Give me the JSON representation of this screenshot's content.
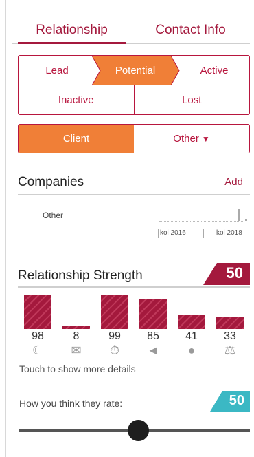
{
  "tabs": [
    {
      "label": "Relationship",
      "active": true
    },
    {
      "label": "Contact Info",
      "active": false
    }
  ],
  "stages": {
    "row1": [
      "Lead",
      "Potential",
      "Active"
    ],
    "selected": "Potential",
    "row2": [
      "Inactive",
      "Lost"
    ]
  },
  "type": {
    "client_label": "Client",
    "other_label": "Other",
    "selected": "Client"
  },
  "companies": {
    "title": "Companies",
    "add_label": "Add",
    "row_label": "Other",
    "timeline": [
      "kol 2016",
      "kol 2018"
    ]
  },
  "strength": {
    "title": "Relationship Strength",
    "score": "50",
    "metrics": [
      {
        "value": 98,
        "label": "98",
        "icon": "moon-icon"
      },
      {
        "value": 8,
        "label": "8",
        "icon": "chat-icon"
      },
      {
        "value": 99,
        "label": "99",
        "icon": "stopwatch-icon"
      },
      {
        "value": 85,
        "label": "85",
        "icon": "megaphone-icon"
      },
      {
        "value": 41,
        "label": "41",
        "icon": "lightbulb-icon"
      },
      {
        "value": 33,
        "label": "33",
        "icon": "scales-icon"
      }
    ],
    "hint": "Touch to show more details"
  },
  "rating": {
    "label": "How you think they rate:",
    "value": "50",
    "level": 50
  },
  "colors": {
    "accent": "#a4193d",
    "stage_selected": "#f07f37",
    "rate_badge": "#3bb8c4"
  }
}
